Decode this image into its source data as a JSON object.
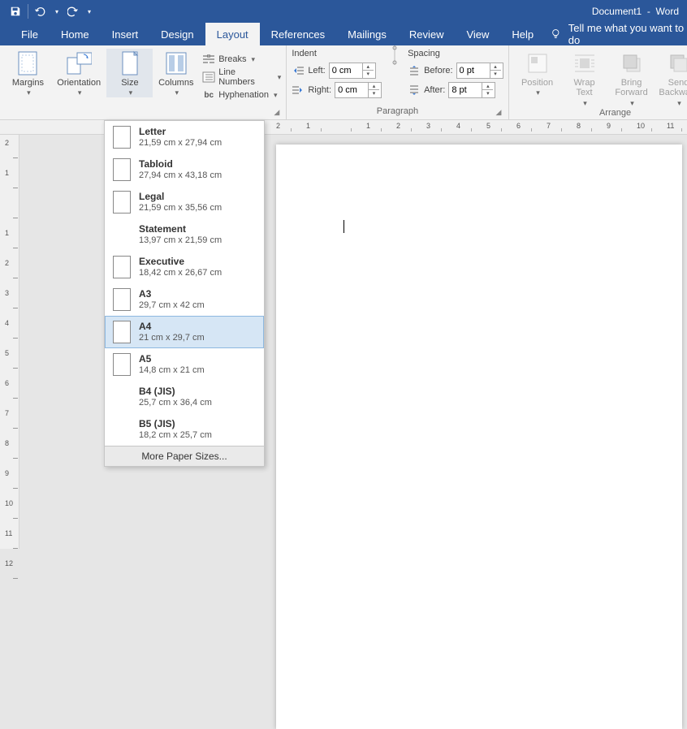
{
  "title": "Document1  -  Word",
  "qat": {
    "save": "save-icon",
    "undo": "undo-icon",
    "redo": "redo-icon"
  },
  "tabs": [
    "File",
    "Home",
    "Insert",
    "Design",
    "Layout",
    "References",
    "Mailings",
    "Review",
    "View",
    "Help"
  ],
  "active_tab": "Layout",
  "tellme": "Tell me what you want to do",
  "ribbon": {
    "page_setup": {
      "margins": "Margins",
      "orientation": "Orientation",
      "size": "Size",
      "columns": "Columns",
      "breaks": "Breaks",
      "line_numbers": "Line Numbers",
      "hyphenation": "Hyphenation",
      "group_label": ""
    },
    "paragraph": {
      "indent_label": "Indent",
      "spacing_label": "Spacing",
      "left_label": "Left:",
      "right_label": "Right:",
      "before_label": "Before:",
      "after_label": "After:",
      "left_val": "0 cm",
      "right_val": "0 cm",
      "before_val": "0 pt",
      "after_val": "8 pt",
      "group_label": "Paragraph"
    },
    "arrange": {
      "position": "Position",
      "wrap_text": "Wrap\nText",
      "bring_forward": "Bring\nForward",
      "send_backward": "Send\nBackward",
      "selection_prefix": "S",
      "group_label": "Arrange"
    }
  },
  "size_menu": {
    "items": [
      {
        "name": "Letter",
        "dim": "21,59 cm x 27,94 cm",
        "thumb": true
      },
      {
        "name": "Tabloid",
        "dim": "27,94 cm x 43,18 cm",
        "thumb": true
      },
      {
        "name": "Legal",
        "dim": "21,59 cm x 35,56 cm",
        "thumb": true
      },
      {
        "name": "Statement",
        "dim": "13,97 cm x 21,59 cm",
        "thumb": false
      },
      {
        "name": "Executive",
        "dim": "18,42 cm x 26,67 cm",
        "thumb": true
      },
      {
        "name": "A3",
        "dim": "29,7 cm x 42 cm",
        "thumb": true
      },
      {
        "name": "A4",
        "dim": "21 cm x 29,7 cm",
        "thumb": true,
        "selected": true
      },
      {
        "name": "A5",
        "dim": "14,8 cm x 21 cm",
        "thumb": true
      },
      {
        "name": "B4 (JIS)",
        "dim": "25,7 cm x 36,4 cm",
        "thumb": false
      },
      {
        "name": "B5 (JIS)",
        "dim": "18,2 cm x 25,7 cm",
        "thumb": false
      }
    ],
    "more": "More Paper Sizes..."
  },
  "ruler": {
    "h_labels": [
      "2",
      "1",
      "",
      "1",
      "2",
      "3",
      "4",
      "5",
      "6",
      "7",
      "8",
      "9",
      "10",
      "11"
    ],
    "v_labels": [
      "2",
      "1",
      "",
      "1",
      "2",
      "3",
      "4",
      "5",
      "6",
      "7",
      "8",
      "9",
      "10",
      "11",
      "12"
    ]
  }
}
